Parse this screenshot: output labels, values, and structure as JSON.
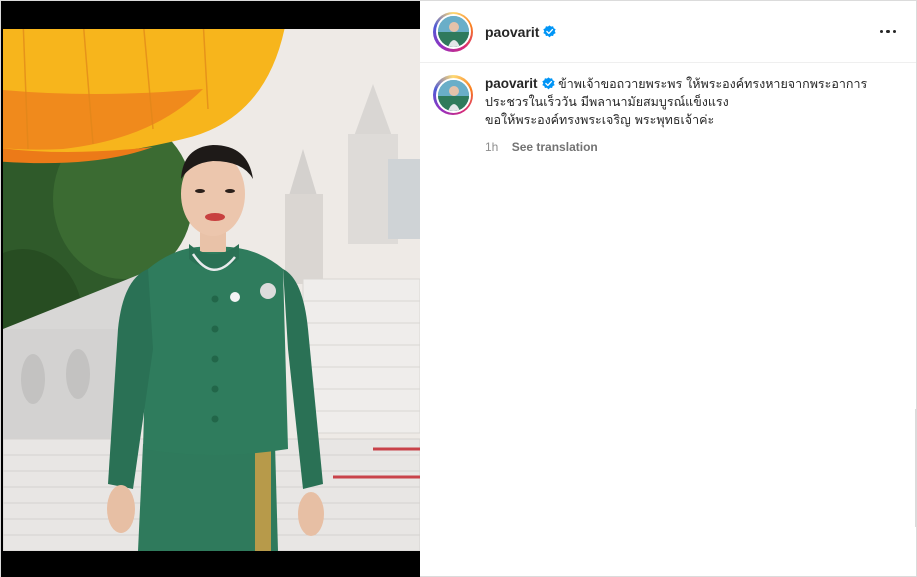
{
  "post": {
    "media": {
      "alt_icon": "photo-image"
    },
    "header": {
      "username": "paovarit",
      "verified_icon": "verified-badge-icon",
      "more_icon": "more-options-icon"
    },
    "caption": {
      "username": "paovarit",
      "line1": "ข้าพเจ้าขอถวายพระพร ให้พระองค์ทรงหายจากพระอาการ",
      "line2": "ประชวรในเร็ววัน มีพลานามัยสมบูรณ์แข็งแรง",
      "line3": "ขอให้พระองค์ทรงพระเจริญ พระพุทธเจ้าค่ะ",
      "time": "1h",
      "see_translation": "See translation"
    },
    "colors": {
      "verified": "#0095f6",
      "text": "#262626",
      "muted": "#8e8e8e"
    }
  }
}
